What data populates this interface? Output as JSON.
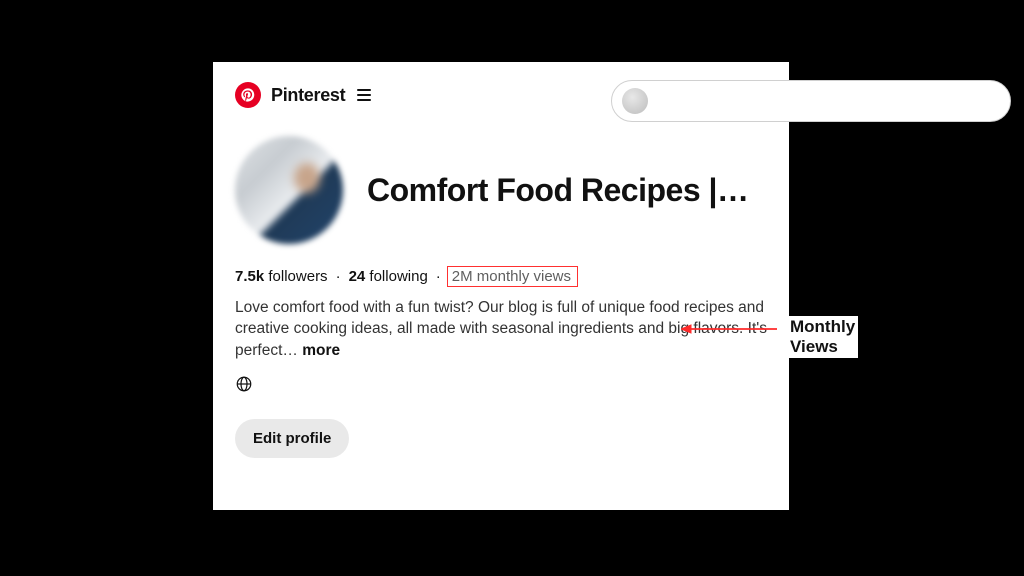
{
  "header": {
    "brand": "Pinterest"
  },
  "profile": {
    "name": "Comfort Food Recipes |…",
    "followers_count": "7.5k",
    "followers_label": "followers",
    "following_count": "24",
    "following_label": "following",
    "monthly_views": "2M monthly views",
    "bio": "Love comfort food with a fun twist? Our blog is full of unique food recipes and creative cooking ideas, all made with seasonal ingredients and big flavors. It's perfect…",
    "more_label": "more",
    "edit_label": "Edit profile"
  },
  "annotation": {
    "label": "Monthly Views"
  }
}
